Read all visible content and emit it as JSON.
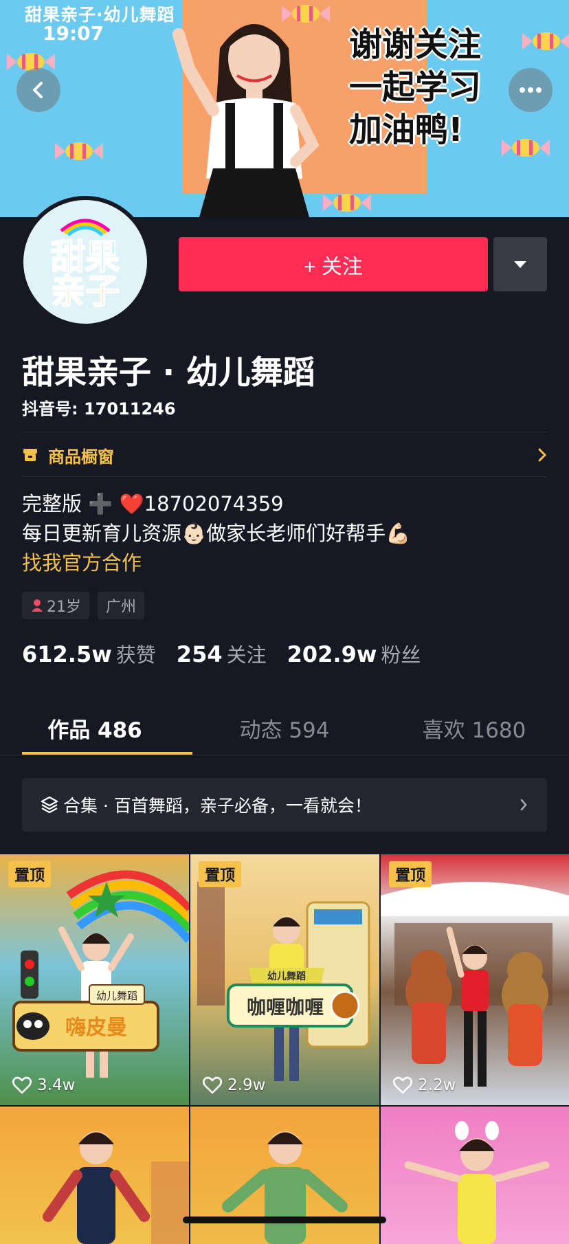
{
  "banner": {
    "title": "甜果亲子·幼儿舞蹈",
    "time": "19:07",
    "slogan": [
      "谢谢关注",
      "一起学习",
      "加油鸭!"
    ]
  },
  "avatar": {
    "line1": "甜果",
    "line2": "亲子"
  },
  "actions": {
    "follow_label": "+ 关注"
  },
  "profile": {
    "name": "甜果亲子 · 幼儿舞蹈",
    "douyin_id": "抖音号: 17011246",
    "shop_label": "商品橱窗",
    "bio": {
      "line1": "完整版 ➕ ❤️18702074359",
      "line2": "每日更新育儿资源👶🏻做家长老师们好帮手💪🏻",
      "link": "找我官方合作"
    },
    "tags": {
      "age": "21岁",
      "city": "广州"
    }
  },
  "stats": {
    "likes_num": "612.5w",
    "likes_label": "获赞",
    "following_num": "254",
    "following_label": "关注",
    "fans_num": "202.9w",
    "fans_label": "粉丝"
  },
  "tabs": [
    {
      "label": "作品 486"
    },
    {
      "label": "动态 594"
    },
    {
      "label": "喜欢 1680"
    }
  ],
  "collection": {
    "label": "合集 · 百首舞蹈，亲子必备，一看就会！"
  },
  "videos": [
    {
      "pin": "置顶",
      "likes": "3.4w",
      "caption_small": "幼儿舞蹈",
      "caption": "嗨皮曼"
    },
    {
      "pin": "置顶",
      "likes": "2.9w",
      "caption_small": "幼儿舞蹈",
      "caption": "咖喱咖喱"
    },
    {
      "pin": "置顶",
      "likes": "2.2w"
    }
  ],
  "colors": {
    "background": "#161823",
    "follow": "#fe2c55",
    "accent": "#f5c14b",
    "banner": "#6cc9ef"
  }
}
